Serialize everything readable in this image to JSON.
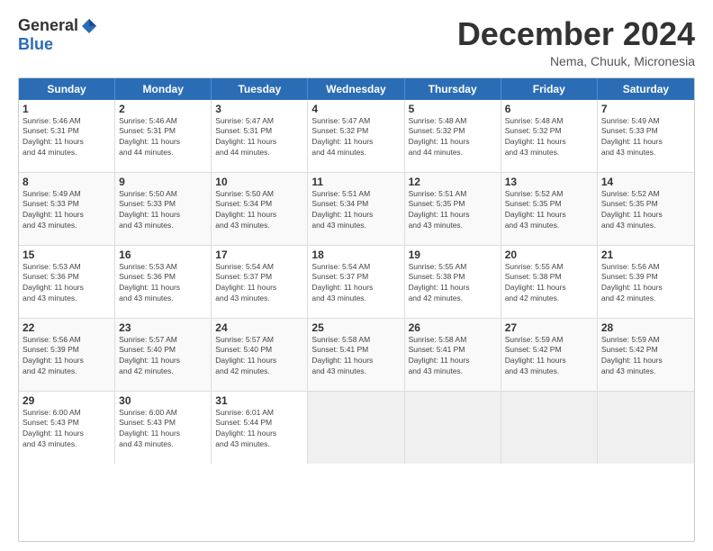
{
  "logo": {
    "general": "General",
    "blue": "Blue"
  },
  "title": "December 2024",
  "location": "Nema, Chuuk, Micronesia",
  "days_of_week": [
    "Sunday",
    "Monday",
    "Tuesday",
    "Wednesday",
    "Thursday",
    "Friday",
    "Saturday"
  ],
  "weeks": [
    [
      {
        "day": 1,
        "info": "Sunrise: 5:46 AM\nSunset: 5:31 PM\nDaylight: 11 hours\nand 44 minutes."
      },
      {
        "day": 2,
        "info": "Sunrise: 5:46 AM\nSunset: 5:31 PM\nDaylight: 11 hours\nand 44 minutes."
      },
      {
        "day": 3,
        "info": "Sunrise: 5:47 AM\nSunset: 5:31 PM\nDaylight: 11 hours\nand 44 minutes."
      },
      {
        "day": 4,
        "info": "Sunrise: 5:47 AM\nSunset: 5:32 PM\nDaylight: 11 hours\nand 44 minutes."
      },
      {
        "day": 5,
        "info": "Sunrise: 5:48 AM\nSunset: 5:32 PM\nDaylight: 11 hours\nand 44 minutes."
      },
      {
        "day": 6,
        "info": "Sunrise: 5:48 AM\nSunset: 5:32 PM\nDaylight: 11 hours\nand 43 minutes."
      },
      {
        "day": 7,
        "info": "Sunrise: 5:49 AM\nSunset: 5:33 PM\nDaylight: 11 hours\nand 43 minutes."
      }
    ],
    [
      {
        "day": 8,
        "info": "Sunrise: 5:49 AM\nSunset: 5:33 PM\nDaylight: 11 hours\nand 43 minutes."
      },
      {
        "day": 9,
        "info": "Sunrise: 5:50 AM\nSunset: 5:33 PM\nDaylight: 11 hours\nand 43 minutes."
      },
      {
        "day": 10,
        "info": "Sunrise: 5:50 AM\nSunset: 5:34 PM\nDaylight: 11 hours\nand 43 minutes."
      },
      {
        "day": 11,
        "info": "Sunrise: 5:51 AM\nSunset: 5:34 PM\nDaylight: 11 hours\nand 43 minutes."
      },
      {
        "day": 12,
        "info": "Sunrise: 5:51 AM\nSunset: 5:35 PM\nDaylight: 11 hours\nand 43 minutes."
      },
      {
        "day": 13,
        "info": "Sunrise: 5:52 AM\nSunset: 5:35 PM\nDaylight: 11 hours\nand 43 minutes."
      },
      {
        "day": 14,
        "info": "Sunrise: 5:52 AM\nSunset: 5:35 PM\nDaylight: 11 hours\nand 43 minutes."
      }
    ],
    [
      {
        "day": 15,
        "info": "Sunrise: 5:53 AM\nSunset: 5:36 PM\nDaylight: 11 hours\nand 43 minutes."
      },
      {
        "day": 16,
        "info": "Sunrise: 5:53 AM\nSunset: 5:36 PM\nDaylight: 11 hours\nand 43 minutes."
      },
      {
        "day": 17,
        "info": "Sunrise: 5:54 AM\nSunset: 5:37 PM\nDaylight: 11 hours\nand 43 minutes."
      },
      {
        "day": 18,
        "info": "Sunrise: 5:54 AM\nSunset: 5:37 PM\nDaylight: 11 hours\nand 43 minutes."
      },
      {
        "day": 19,
        "info": "Sunrise: 5:55 AM\nSunset: 5:38 PM\nDaylight: 11 hours\nand 42 minutes."
      },
      {
        "day": 20,
        "info": "Sunrise: 5:55 AM\nSunset: 5:38 PM\nDaylight: 11 hours\nand 42 minutes."
      },
      {
        "day": 21,
        "info": "Sunrise: 5:56 AM\nSunset: 5:39 PM\nDaylight: 11 hours\nand 42 minutes."
      }
    ],
    [
      {
        "day": 22,
        "info": "Sunrise: 5:56 AM\nSunset: 5:39 PM\nDaylight: 11 hours\nand 42 minutes."
      },
      {
        "day": 23,
        "info": "Sunrise: 5:57 AM\nSunset: 5:40 PM\nDaylight: 11 hours\nand 42 minutes."
      },
      {
        "day": 24,
        "info": "Sunrise: 5:57 AM\nSunset: 5:40 PM\nDaylight: 11 hours\nand 42 minutes."
      },
      {
        "day": 25,
        "info": "Sunrise: 5:58 AM\nSunset: 5:41 PM\nDaylight: 11 hours\nand 43 minutes."
      },
      {
        "day": 26,
        "info": "Sunrise: 5:58 AM\nSunset: 5:41 PM\nDaylight: 11 hours\nand 43 minutes."
      },
      {
        "day": 27,
        "info": "Sunrise: 5:59 AM\nSunset: 5:42 PM\nDaylight: 11 hours\nand 43 minutes."
      },
      {
        "day": 28,
        "info": "Sunrise: 5:59 AM\nSunset: 5:42 PM\nDaylight: 11 hours\nand 43 minutes."
      }
    ],
    [
      {
        "day": 29,
        "info": "Sunrise: 6:00 AM\nSunset: 5:43 PM\nDaylight: 11 hours\nand 43 minutes."
      },
      {
        "day": 30,
        "info": "Sunrise: 6:00 AM\nSunset: 5:43 PM\nDaylight: 11 hours\nand 43 minutes."
      },
      {
        "day": 31,
        "info": "Sunrise: 6:01 AM\nSunset: 5:44 PM\nDaylight: 11 hours\nand 43 minutes."
      },
      null,
      null,
      null,
      null
    ]
  ]
}
